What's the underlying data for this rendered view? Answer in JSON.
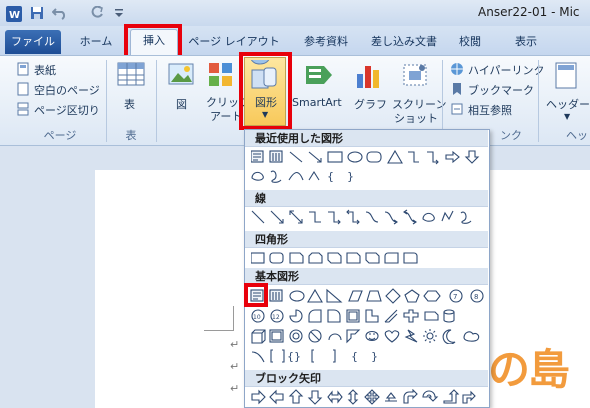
{
  "window": {
    "title": "Anser22-01 - Mic"
  },
  "tabs": [
    {
      "label": "ファイル"
    },
    {
      "label": "ホーム"
    },
    {
      "label": "挿入"
    },
    {
      "label": "ページ レイアウト"
    },
    {
      "label": "参考資料"
    },
    {
      "label": "差し込み文書"
    },
    {
      "label": "校閲"
    },
    {
      "label": "表示"
    }
  ],
  "ribbon": {
    "page_group": {
      "cover": "表紙",
      "blank": "空白のページ",
      "break": "ページ区切り",
      "label": "ページ"
    },
    "table_group": {
      "table": "表",
      "label": "表"
    },
    "illust": {
      "picture": "図",
      "clipart_1": "クリップ",
      "clipart_2": "アート",
      "shapes": "図形",
      "smartart": "SmartArt",
      "chart": "グラフ",
      "screenshot_1": "スクリーン",
      "screenshot_2": "ショット"
    },
    "links": {
      "hyperlink": "ハイパーリンク",
      "bookmark": "ブックマーク",
      "crossref": "相互参照",
      "label": "ンク"
    },
    "header": {
      "label": "ヘッダー",
      "group": "ヘッ"
    }
  },
  "gallery": {
    "recent": "最近使用した図形",
    "lines": "線",
    "rect": "四角形",
    "basic": "基本図形",
    "block": "ブロック矢印"
  },
  "doc": {
    "mark": "↵"
  },
  "watermark": "の島",
  "colors": {
    "highlight": "#e8000b",
    "file_tab": "#2a5aa0"
  }
}
